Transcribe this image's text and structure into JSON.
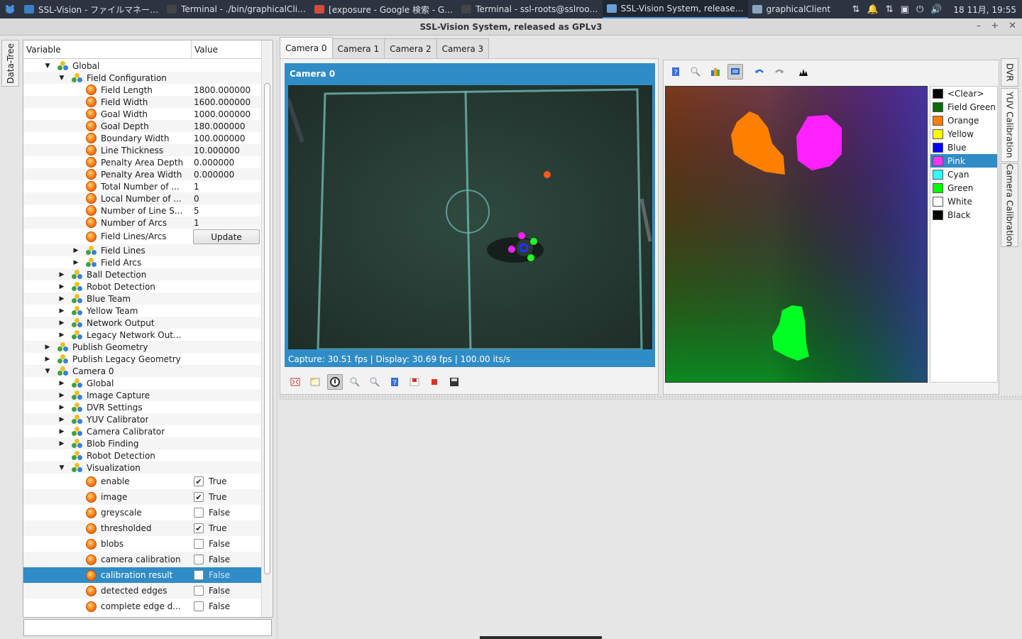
{
  "taskbar": {
    "tasks": [
      {
        "label": "SSL-Vision - ファイルマネー…",
        "icon": "folder-icon",
        "color": "#3d7fc4"
      },
      {
        "label": "Terminal - ./bin/graphicalCli…",
        "icon": "terminal-icon",
        "color": "#444444"
      },
      {
        "label": "[exposure - Google 検索 - G…",
        "icon": "chrome-icon",
        "color": "#d44b3c"
      },
      {
        "label": "Terminal - ssl-roots@sslroo…",
        "icon": "terminal-icon",
        "color": "#444444"
      },
      {
        "label": "SSL-Vision System, release…",
        "icon": "window-icon",
        "color": "#6aa0d8"
      },
      {
        "label": "graphicalClient",
        "icon": "window-icon",
        "color": "#8aa4c0"
      }
    ],
    "clock": "18 11月, 19:55"
  },
  "window": {
    "title": "SSL-Vision System, released as GPLv3"
  },
  "left_dock": {
    "label": "Data-Tree"
  },
  "tree": {
    "col_variable": "Variable",
    "col_value": "Value",
    "filter_value": "",
    "update_label": "Update",
    "rows": [
      {
        "d": 2,
        "a": "▼",
        "t": "g",
        "n": "Global"
      },
      {
        "d": 3,
        "a": "▼",
        "t": "g",
        "n": "Field Configuration"
      },
      {
        "d": 4,
        "a": "",
        "t": "o",
        "n": "Field Length",
        "v": "1800.000000"
      },
      {
        "d": 4,
        "a": "",
        "t": "o",
        "n": "Field Width",
        "v": "1600.000000"
      },
      {
        "d": 4,
        "a": "",
        "t": "o",
        "n": "Goal Width",
        "v": "1000.000000"
      },
      {
        "d": 4,
        "a": "",
        "t": "o",
        "n": "Goal Depth",
        "v": "180.000000"
      },
      {
        "d": 4,
        "a": "",
        "t": "o",
        "n": "Boundary Width",
        "v": "100.000000"
      },
      {
        "d": 4,
        "a": "",
        "t": "o",
        "n": "Line Thickness",
        "v": "10.000000"
      },
      {
        "d": 4,
        "a": "",
        "t": "o",
        "n": "Penalty Area Depth",
        "v": "0.000000"
      },
      {
        "d": 4,
        "a": "",
        "t": "o",
        "n": "Penalty Area Width",
        "v": "0.000000"
      },
      {
        "d": 4,
        "a": "",
        "t": "o",
        "n": "Total Number of ...",
        "v": "1"
      },
      {
        "d": 4,
        "a": "",
        "t": "o",
        "n": "Local Number of ...",
        "v": "0"
      },
      {
        "d": 4,
        "a": "",
        "t": "o",
        "n": "Number of Line S...",
        "v": "5"
      },
      {
        "d": 4,
        "a": "",
        "t": "o",
        "n": "Number of Arcs",
        "v": "1"
      },
      {
        "d": 4,
        "a": "",
        "t": "o",
        "n": "Field Lines/Arcs",
        "btn": true
      },
      {
        "d": 4,
        "a": "▶",
        "t": "g",
        "n": "Field Lines"
      },
      {
        "d": 4,
        "a": "▶",
        "t": "g",
        "n": "Field Arcs"
      },
      {
        "d": 3,
        "a": "▶",
        "t": "g",
        "n": "Ball Detection"
      },
      {
        "d": 3,
        "a": "▶",
        "t": "g",
        "n": "Robot Detection"
      },
      {
        "d": 3,
        "a": "▶",
        "t": "g",
        "n": "Blue Team"
      },
      {
        "d": 3,
        "a": "▶",
        "t": "g",
        "n": "Yellow Team"
      },
      {
        "d": 3,
        "a": "▶",
        "t": "g",
        "n": "Network Output"
      },
      {
        "d": 3,
        "a": "▶",
        "t": "g",
        "n": "Legacy Network Out..."
      },
      {
        "d": 2,
        "a": "▶",
        "t": "g",
        "n": "Publish Geometry"
      },
      {
        "d": 2,
        "a": "▶",
        "t": "g",
        "n": "Publish Legacy Geometry"
      },
      {
        "d": 2,
        "a": "▼",
        "t": "g",
        "n": "Camera 0"
      },
      {
        "d": 3,
        "a": "▶",
        "t": "g",
        "n": "Global"
      },
      {
        "d": 3,
        "a": "▶",
        "t": "g",
        "n": "Image Capture"
      },
      {
        "d": 3,
        "a": "▶",
        "t": "g",
        "n": "DVR Settings"
      },
      {
        "d": 3,
        "a": "▶",
        "t": "g",
        "n": "YUV Calibrator"
      },
      {
        "d": 3,
        "a": "▶",
        "t": "g",
        "n": "Camera Calibrator"
      },
      {
        "d": 3,
        "a": "▶",
        "t": "g",
        "n": "Blob Finding"
      },
      {
        "d": 3,
        "a": "",
        "t": "g",
        "n": "Robot Detection"
      },
      {
        "d": 3,
        "a": "▼",
        "t": "g",
        "n": "Visualization"
      },
      {
        "d": 4,
        "a": "",
        "t": "o",
        "n": "enable",
        "cb": true,
        "v": "True",
        "tall": true
      },
      {
        "d": 4,
        "a": "",
        "t": "o",
        "n": "image",
        "cb": true,
        "v": "True",
        "tall": true
      },
      {
        "d": 4,
        "a": "",
        "t": "o",
        "n": "greyscale",
        "cb": false,
        "v": "False",
        "tall": true
      },
      {
        "d": 4,
        "a": "",
        "t": "o",
        "n": "thresholded",
        "cb": true,
        "v": "True",
        "tall": true
      },
      {
        "d": 4,
        "a": "",
        "t": "o",
        "n": "blobs",
        "cb": false,
        "v": "False",
        "tall": true
      },
      {
        "d": 4,
        "a": "",
        "t": "o",
        "n": "camera calibration",
        "cb": false,
        "v": "False",
        "tall": true
      },
      {
        "d": 4,
        "a": "",
        "t": "o",
        "n": "calibration result",
        "cb": false,
        "v": "False",
        "tall": true,
        "sel": true
      },
      {
        "d": 4,
        "a": "",
        "t": "o",
        "n": "detected edges",
        "cb": false,
        "v": "False",
        "tall": true
      },
      {
        "d": 4,
        "a": "",
        "t": "o",
        "n": "complete edge d...",
        "cb": false,
        "v": "False",
        "tall": true
      }
    ]
  },
  "camera_tabs": [
    "Camera 0",
    "Camera 1",
    "Camera 2",
    "Camera 3"
  ],
  "camera_view": {
    "title": "Camera 0",
    "status": "Capture: 30.51 fps | Display: 30.69 fps | 100.00 its/s"
  },
  "camera_toolbar": [
    "fullscreen-icon",
    "folder-open-icon",
    "pause-icon",
    "zoom-in-icon",
    "zoom-out-icon",
    "help-icon",
    "record-icon",
    "stop-icon",
    "save-icon"
  ],
  "yuv_toolbar": [
    "help-icon",
    "zoom-icon",
    "palette-icon",
    "screen-icon",
    "undo-icon",
    "redo-icon",
    "histogram-icon"
  ],
  "colors": [
    {
      "name": "<Clear>",
      "color": "#000000"
    },
    {
      "name": "Field Green",
      "color": "#0a6b0a"
    },
    {
      "name": "Orange",
      "color": "#ff8000"
    },
    {
      "name": "Yellow",
      "color": "#ffff00"
    },
    {
      "name": "Blue",
      "color": "#0000ff"
    },
    {
      "name": "Pink",
      "color": "#ff33ff",
      "selected": true
    },
    {
      "name": "Cyan",
      "color": "#33ffff"
    },
    {
      "name": "Green",
      "color": "#00ff00"
    },
    {
      "name": "White",
      "color": "#ffffff"
    },
    {
      "name": "Black",
      "color": "#000000"
    }
  ],
  "right_tabs": [
    "DVR",
    "YUV Calibration",
    "Camera Calibration"
  ],
  "theme": {
    "accent": "#308cc6",
    "taskbar": "#2b3440"
  }
}
